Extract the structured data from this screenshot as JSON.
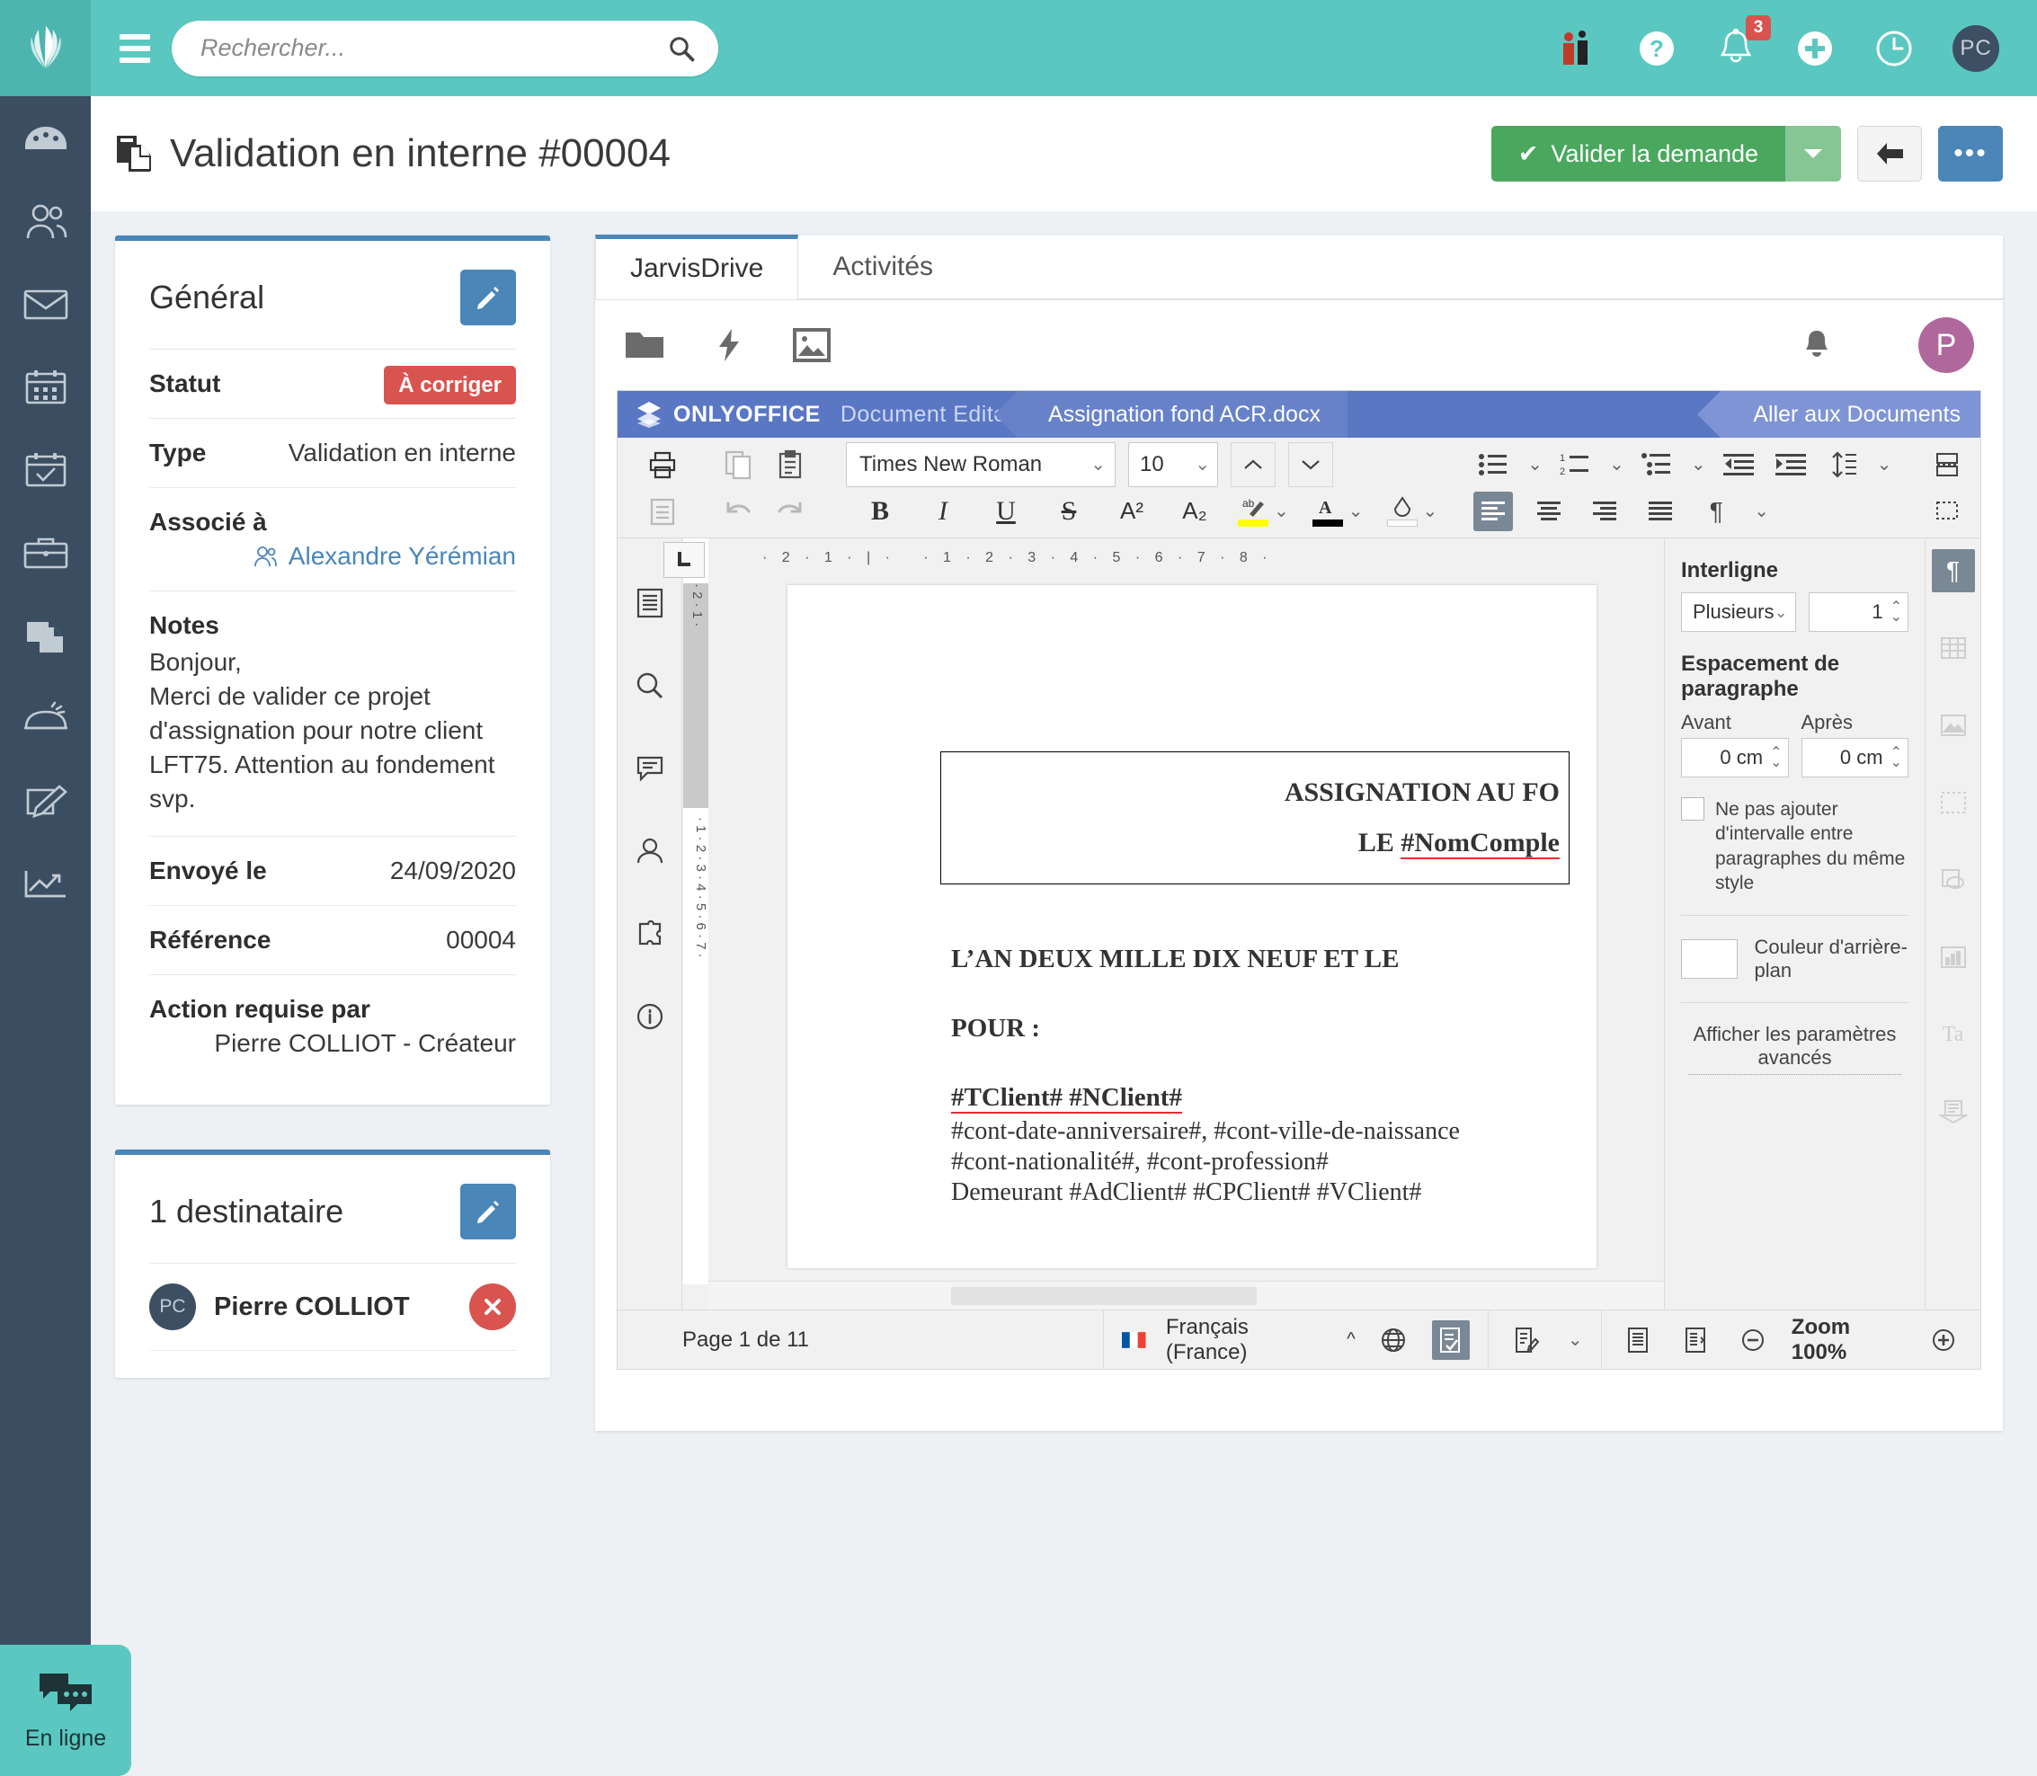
{
  "topbar": {
    "brand_icon": "jarvis-logo-icon",
    "menu_icon": "hamburger-icon",
    "search": {
      "placeholder": "Rechercher...",
      "value": "",
      "icon": "search-icon"
    },
    "icons": [
      {
        "name": "people-icon",
        "label": ""
      },
      {
        "name": "help-icon",
        "label": ""
      },
      {
        "name": "bell-icon",
        "badge": "3"
      },
      {
        "name": "plus-circle-icon",
        "label": ""
      },
      {
        "name": "clock-icon",
        "label": ""
      }
    ],
    "avatar_initials": "PC"
  },
  "leftnav": {
    "items": [
      {
        "name": "sidebar-item-dashboard",
        "icon": "gauge-icon"
      },
      {
        "name": "sidebar-item-contacts",
        "icon": "people-icon"
      },
      {
        "name": "sidebar-item-mail",
        "icon": "envelope-icon"
      },
      {
        "name": "sidebar-item-calendar",
        "icon": "calendar-icon"
      },
      {
        "name": "sidebar-item-tasks",
        "icon": "calendar-check-icon"
      },
      {
        "name": "sidebar-item-briefcase",
        "icon": "briefcase-icon"
      },
      {
        "name": "sidebar-item-documents",
        "icon": "documents-icon"
      },
      {
        "name": "sidebar-item-drive",
        "icon": "drive-icon"
      },
      {
        "name": "sidebar-item-notes",
        "icon": "edit-note-icon"
      },
      {
        "name": "sidebar-item-reports",
        "icon": "chart-line-icon"
      }
    ]
  },
  "chat_widget": {
    "label": "En ligne",
    "icon": "chat-bubbles-icon"
  },
  "pageheader": {
    "title": "Validation en interne #00004",
    "title_icon": "document-copy-icon",
    "validate_label": "Valider la demande",
    "validate_check": "✔",
    "caret_icon": "chevron-down-icon",
    "back_icon": "arrow-left-icon",
    "more_label": "•••"
  },
  "general_card": {
    "title": "Général",
    "edit_icon": "pencil-icon",
    "fields": [
      {
        "label": "Statut",
        "value": "À corriger",
        "type": "badge",
        "color": "#d9534f"
      },
      {
        "label": "Type",
        "value": "Validation en interne",
        "type": "text"
      }
    ],
    "associe_label": "Associé à",
    "associe_value": "Alexandre Yérémian",
    "associe_icon": "user-icon",
    "notes_label": "Notes",
    "notes_value": "Bonjour,\nMerci de valider ce projet d'assignation pour notre client LFT75. Attention au fondement svp.",
    "sent_label": "Envoyé le",
    "sent_value": "24/09/2020",
    "ref_label": "Référence",
    "ref_value": "00004",
    "action_label": "Action requise par",
    "action_value": "Pierre COLLIOT - Créateur"
  },
  "recipients_card": {
    "title": "1 destinataire",
    "edit_icon": "pencil-icon",
    "items": [
      {
        "initials": "PC",
        "name": "Pierre COLLIOT",
        "remove_icon": "close-icon"
      }
    ]
  },
  "rightpanel": {
    "tabs": [
      {
        "label": "JarvisDrive",
        "active": true
      },
      {
        "label": "Activités",
        "active": false
      }
    ],
    "drivebar": {
      "icons": [
        "folder-icon",
        "lightning-icon",
        "image-icon"
      ],
      "bell_icon": "bell-icon",
      "avatar_initial": "P",
      "avatar_color": "#b0689c"
    }
  },
  "onlyoffice": {
    "brand": "ONLYOFFICE",
    "brand_sub": "Document Editor",
    "filename": "Assignation fond ACR.docx",
    "go_to_documents": "Aller aux Documents",
    "toolbar": {
      "print_icon": "print-icon",
      "save_icon": "save-icon",
      "copy_icon": "copy-icon",
      "paste_icon": "paste-icon",
      "undo_icon": "undo-icon",
      "redo_icon": "redo-icon",
      "font_family": "Times New Roman",
      "font_size": "10",
      "increase_font_icon": "caret-up-icon",
      "decrease_font_icon": "caret-down-icon",
      "bold": "B",
      "italic": "I",
      "underline": "U",
      "strike": "S",
      "superscript": "A²",
      "subscript": "A₂",
      "highlight_icon": "highlight-icon",
      "highlight_color": "#ffff00",
      "fontcolor_icon": "font-color-icon",
      "fontcolor": "#000000",
      "clearstyle_icon": "clear-style-icon",
      "bullets_icon": "bullet-list-icon",
      "numbering_icon": "numbered-list-icon",
      "multilevel_icon": "multilevel-list-icon",
      "outdent_icon": "decrease-indent-icon",
      "indent_icon": "increase-indent-icon",
      "linespacing_icon": "line-spacing-icon",
      "align_left_icon": "align-left-icon",
      "align_center_icon": "align-center-icon",
      "align_right_icon": "align-right-icon",
      "align_justify_icon": "align-justify-icon",
      "pilcrow_icon": "pilcrow-icon",
      "pagebreak_icon": "page-break-icon",
      "insert_image_icon": "insert-image-icon",
      "insert_chart_icon": "insert-chart-icon",
      "textbox_icon": "text-box-icon",
      "equation_icon": "equation-icon",
      "dropcap_icon": "drop-cap-icon",
      "columns_icon": "columns-icon",
      "table_icon": "insert-table-icon",
      "link_icon": "hyperlink-icon",
      "shape_icon": "insert-shape-icon",
      "footnote_icon": "footnote-icon"
    },
    "lefttools": [
      "navigation-icon",
      "search-icon",
      "comments-icon",
      "user-icon",
      "plugins-icon",
      "info-icon"
    ],
    "righttools": [
      "paragraph-settings-icon",
      "table-settings-icon",
      "image-settings-icon",
      "header-footer-settings-icon",
      "shape-settings-icon",
      "chart-settings-icon",
      "text-art-settings-icon",
      "mail-merge-icon"
    ],
    "properties": {
      "interligne_label": "Interligne",
      "interligne_mode": "Plusieurs",
      "interligne_value": "1",
      "spacing_label": "Espacement de paragraphe",
      "before_label": "Avant",
      "after_label": "Après",
      "before_value": "0 cm",
      "after_value": "0 cm",
      "nospace_label": "Ne pas ajouter d'intervalle entre paragraphes du même style",
      "nospace_checked": false,
      "bgcolor_label": "Couleur d'arrière-plan",
      "bgcolor_value": "#ffffff",
      "advanced_label": "Afficher les paramètres avancés"
    },
    "document": {
      "header_line1": "ASSIGNATION AU FO",
      "header_line2_prefix": "LE ",
      "header_line2_field": "#NomComple",
      "line_an": "L’AN DEUX MILLE DIX NEUF ET LE",
      "line_pour": "POUR :",
      "line_client": "#TClient# #NClient#",
      "line_2": "#cont-date-anniversaire#, #cont-ville-de-naissance",
      "line_3": "#cont-nationalité#, #cont-profession#",
      "line_4": "Demeurant #AdClient# #CPClient# #VClient#"
    },
    "status": {
      "page_label": "Page 1 de 11",
      "language": "Français (France)",
      "lang_caret": "^",
      "flag_icon": "france-flag-icon",
      "globe_icon": "globe-icon",
      "spellcheck_icon": "spellcheck-icon",
      "trackchanges_icon": "track-changes-icon",
      "viewmode1_icon": "fit-page-icon",
      "viewmode2_icon": "fit-width-icon",
      "zoom_out_icon": "zoom-out-icon",
      "zoom_label": "Zoom 100%",
      "zoom_in_icon": "zoom-in-icon"
    }
  }
}
